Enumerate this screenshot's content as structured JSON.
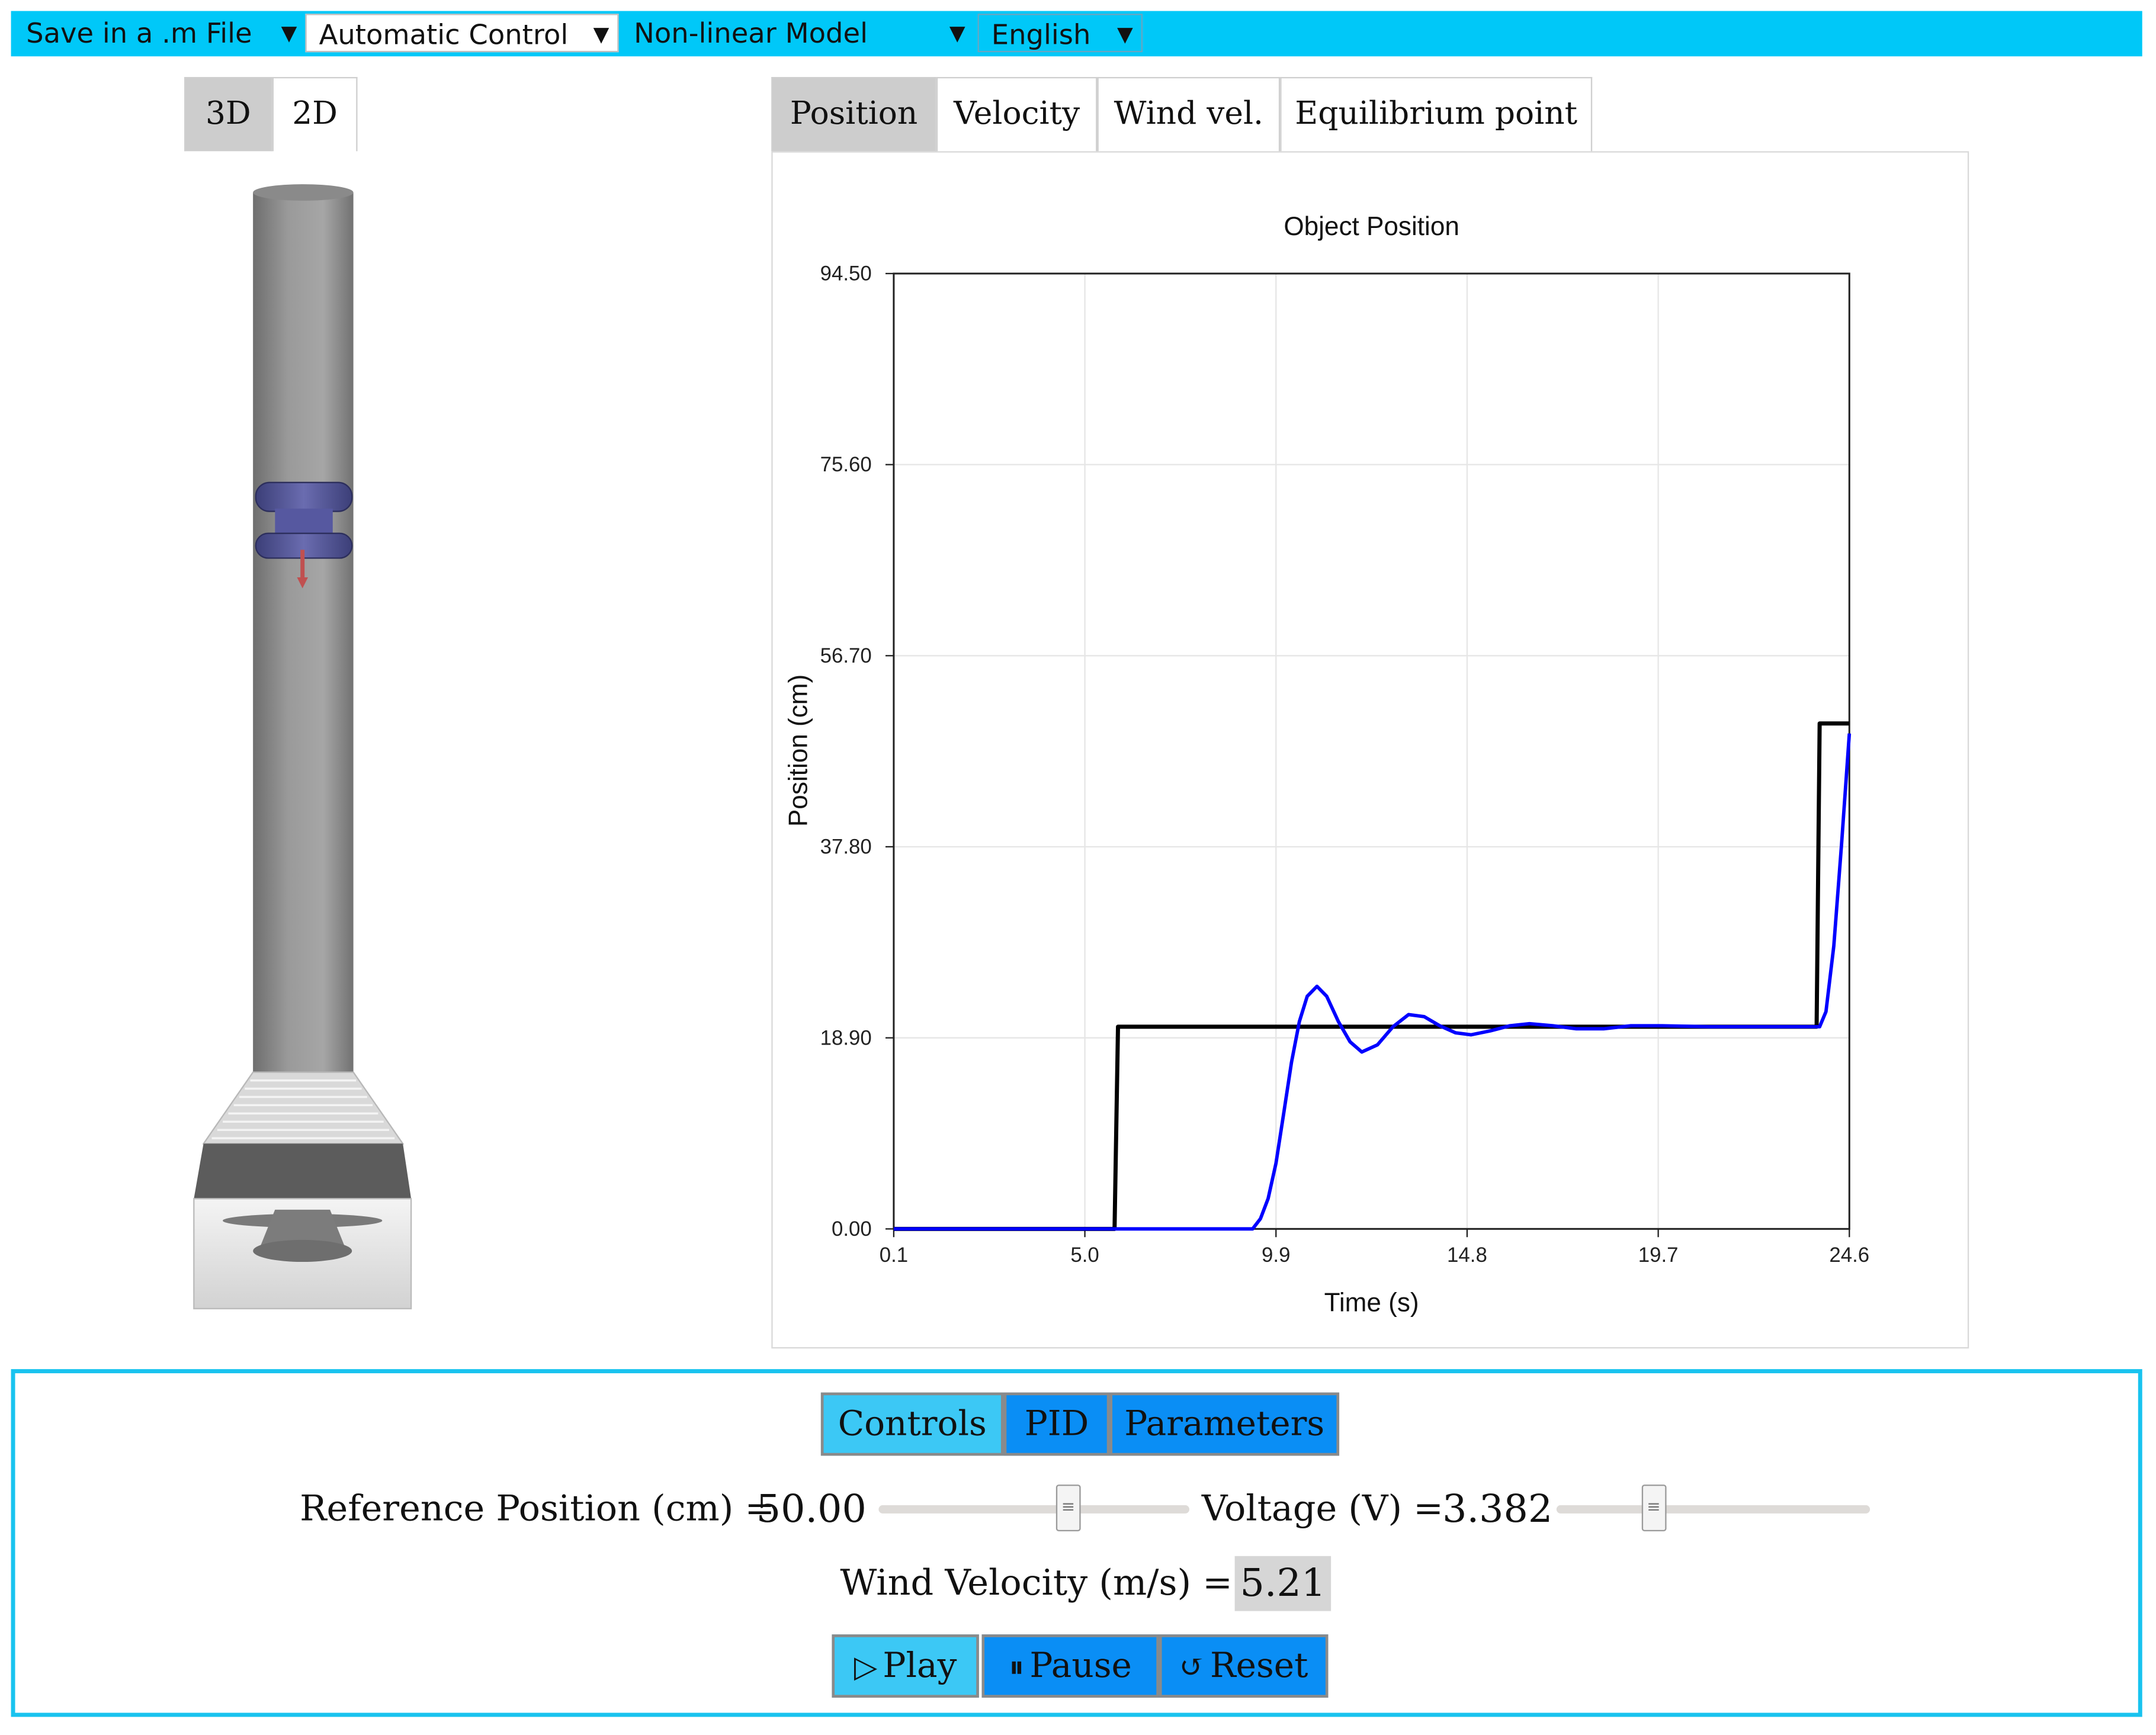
{
  "menubar": {
    "save": "Save in a .m File",
    "control": "Automatic Control",
    "model": "Non-linear Model",
    "language": "English"
  },
  "view_tabs": [
    {
      "label": "3D",
      "active": true
    },
    {
      "label": "2D",
      "active": false
    }
  ],
  "plot_tabs": [
    {
      "label": "Position",
      "active": true
    },
    {
      "label": "Velocity",
      "active": false
    },
    {
      "label": "Wind vel.",
      "active": false
    },
    {
      "label": "Equilibrium point",
      "active": false
    }
  ],
  "chart_data": {
    "type": "line",
    "title": "Object Position",
    "xlabel": "Time (s)",
    "ylabel": "Position (cm)",
    "xlim": [
      0.1,
      24.6
    ],
    "ylim": [
      0.0,
      94.5
    ],
    "x_ticks": [
      "0.1",
      "5.0",
      "9.9",
      "14.8",
      "19.7",
      "24.6"
    ],
    "y_ticks": [
      "0.00",
      "18.90",
      "37.80",
      "56.70",
      "75.60",
      "94.50"
    ],
    "grid": true,
    "series": [
      {
        "color": "#000000",
        "points": [
          [
            0.1,
            0
          ],
          [
            5.76,
            0
          ],
          [
            5.85,
            20
          ],
          [
            23.76,
            20
          ],
          [
            23.84,
            50
          ],
          [
            24.6,
            50
          ]
        ]
      },
      {
        "color": "#0000ff",
        "points": [
          [
            0.1,
            0
          ],
          [
            9.3,
            0
          ],
          [
            9.5,
            1.0
          ],
          [
            9.7,
            3.0
          ],
          [
            9.9,
            6.5
          ],
          [
            10.1,
            11.5
          ],
          [
            10.3,
            16.5
          ],
          [
            10.5,
            20.5
          ],
          [
            10.7,
            23.0
          ],
          [
            10.95,
            24.0
          ],
          [
            11.2,
            23.0
          ],
          [
            11.5,
            20.5
          ],
          [
            11.8,
            18.5
          ],
          [
            12.1,
            17.5
          ],
          [
            12.5,
            18.2
          ],
          [
            12.9,
            20.0
          ],
          [
            13.3,
            21.2
          ],
          [
            13.7,
            21.0
          ],
          [
            14.1,
            20.1
          ],
          [
            14.5,
            19.4
          ],
          [
            14.9,
            19.2
          ],
          [
            15.4,
            19.6
          ],
          [
            15.9,
            20.1
          ],
          [
            16.4,
            20.3
          ],
          [
            17.0,
            20.1
          ],
          [
            17.6,
            19.8
          ],
          [
            18.3,
            19.8
          ],
          [
            19.0,
            20.1
          ],
          [
            19.8,
            20.1
          ],
          [
            21.0,
            20.0
          ],
          [
            23.84,
            20.0
          ],
          [
            24.0,
            21.5
          ],
          [
            24.2,
            28.0
          ],
          [
            24.4,
            38.0
          ],
          [
            24.6,
            49.0
          ]
        ]
      }
    ]
  },
  "panel": {
    "tabs": {
      "controls": "Controls",
      "pid": "PID",
      "parameters": "Parameters"
    },
    "reference_label": "Reference Position (cm) =",
    "reference_value": "50.00",
    "reference_slider": 0.61,
    "voltage_label": "Voltage (V) =",
    "voltage_value": "3.382",
    "voltage_slider": 0.31,
    "wind_label": "Wind Velocity (m/s) =",
    "wind_value": "5.21",
    "buttons": {
      "play": "Play",
      "pause": "Pause",
      "reset": "Reset"
    }
  }
}
